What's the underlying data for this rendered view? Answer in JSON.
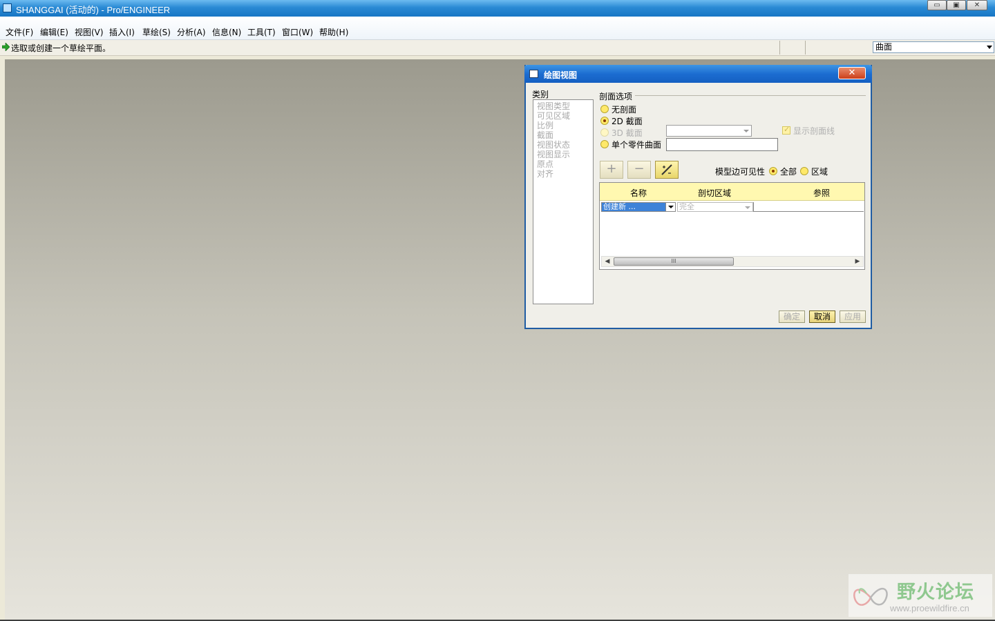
{
  "window": {
    "title": "SHANGGAI (活动的) - Pro/ENGINEER",
    "controls": {
      "minimize": "▭",
      "restore": "▣",
      "close": "✕"
    }
  },
  "menu": {
    "items": [
      "文件(F)",
      "编辑(E)",
      "视图(V)",
      "插入(I)",
      "草绘(S)",
      "分析(A)",
      "信息(N)",
      "工具(T)",
      "窗口(W)",
      "帮助(H)"
    ]
  },
  "prompt": {
    "message": "选取或创建一个草绘平面。",
    "filter_value": "曲面"
  },
  "dialog": {
    "title": "绘图视图",
    "close_label": "✕",
    "category_label": "类别",
    "categories": [
      "视图类型",
      "可见区域",
      "比例",
      "截面",
      "视图状态",
      "视图显示",
      "原点",
      "对齐"
    ],
    "section_group_label": "剖面选项",
    "options": {
      "no_section": "无剖面",
      "section_2d": "2D 截面",
      "section_3d": "3D 截面",
      "single_part_surface": "单个零件曲面"
    },
    "selected_option": "2D 截面",
    "show_hatch_label": "显示剖面线",
    "toolbar": {
      "add": "+",
      "remove": "−",
      "edit": "⁄"
    },
    "model_edge_visibility_label": "模型边可见性",
    "visibility_options": {
      "all": "全部",
      "area": "区域"
    },
    "visibility_selected": "全部",
    "table": {
      "headers": [
        "名称",
        "剖切区域",
        "参照"
      ],
      "row": {
        "name": "创建新 ...",
        "area": "完全",
        "ref": ""
      }
    },
    "scroll_thumb": "III",
    "buttons": {
      "ok": "确定",
      "cancel": "取消",
      "apply": "应用"
    }
  },
  "watermark": {
    "name": "野火论坛",
    "url": "www.proewildfire.cn"
  },
  "colors": {
    "titlebar": "#1776c4",
    "dialog_title": "#1c6dd1",
    "radio_fill": "#ffe96a",
    "table_header": "#fff8b0"
  }
}
